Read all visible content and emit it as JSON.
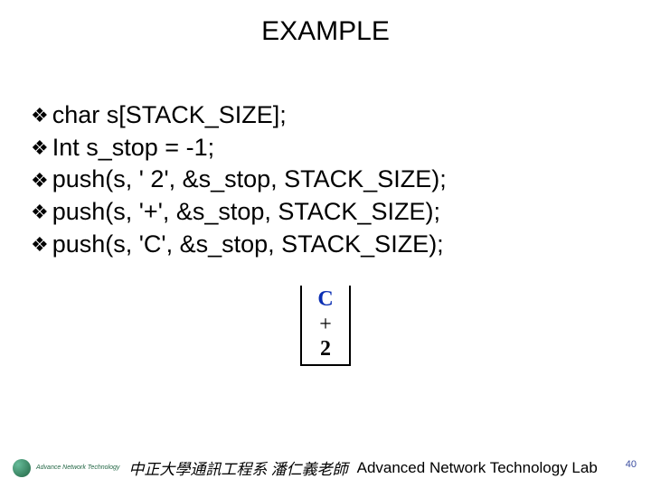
{
  "title": "EXAMPLE",
  "lines": {
    "l1": "char s[STACK_SIZE];",
    "l2": "Int s_stop = -1;",
    "l3": "push(s, ' 2', &s_stop, STACK_SIZE);",
    "l4": "push(s, '+', &s_stop, STACK_SIZE);",
    "l5": "push(s, 'C', &s_stop, STACK_SIZE);"
  },
  "stack": {
    "top": "C",
    "mid": "+",
    "bot": "2"
  },
  "footer": {
    "logotext": "Advance\nNetwork\nTechnology",
    "chinese": "中正大學通訊工程系 潘仁義老師",
    "english": "Advanced Network Technology Lab"
  },
  "page": "40",
  "bullet": "❖"
}
